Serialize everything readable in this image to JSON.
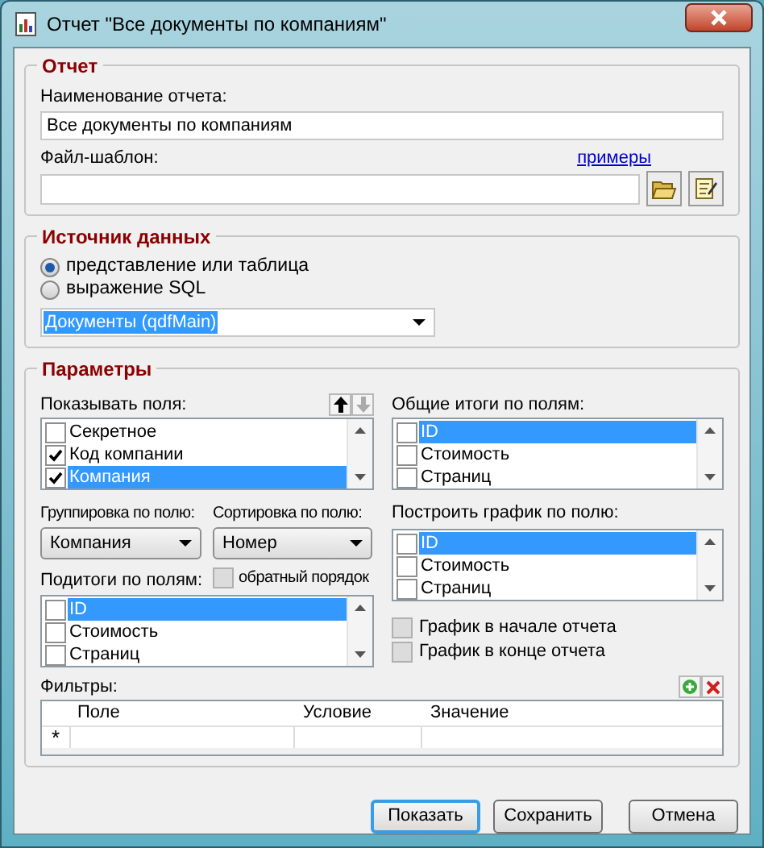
{
  "window": {
    "title": "Отчет \"Все документы по компаниям\""
  },
  "report": {
    "legend": "Отчет",
    "name_label": "Наименование отчета:",
    "name_value": "Все документы по компаниям",
    "template_label": "Файл-шаблон:",
    "examples_link": "примеры"
  },
  "source": {
    "legend": "Источник данных",
    "options": [
      {
        "label": "представление или таблица",
        "selected": true
      },
      {
        "label": "выражение SQL",
        "selected": false
      }
    ],
    "table": "Документы (qdfMain)"
  },
  "params": {
    "legend": "Параметры",
    "show_fields": {
      "label": "Показывать поля:",
      "items": [
        {
          "label": "Секретное",
          "checked": false,
          "selected": false
        },
        {
          "label": "Код компании",
          "checked": true,
          "selected": false
        },
        {
          "label": "Компания",
          "checked": true,
          "selected": true
        }
      ]
    },
    "totals": {
      "label": "Общие итоги по полям:",
      "items": [
        {
          "label": "ID",
          "checked": false,
          "selected": true
        },
        {
          "label": "Стоимость",
          "checked": false,
          "selected": false
        },
        {
          "label": "Страниц",
          "checked": false,
          "selected": false
        }
      ]
    },
    "group_by": {
      "label": "Группировка по полю:",
      "value": "Компания"
    },
    "sort_by": {
      "label": "Сортировка по полю:",
      "value": "Номер"
    },
    "reverse": {
      "label": "обратный порядок",
      "checked": false,
      "disabled": true
    },
    "subtotals": {
      "label": "Подитоги по полям:",
      "items": [
        {
          "label": "ID",
          "checked": false,
          "selected": true
        },
        {
          "label": "Стоимость",
          "checked": false,
          "selected": false
        },
        {
          "label": "Страниц",
          "checked": false,
          "selected": false
        }
      ]
    },
    "chart_by": {
      "label": "Построить график по полю:",
      "items": [
        {
          "label": "ID",
          "checked": false,
          "selected": true
        },
        {
          "label": "Стоимость",
          "checked": false,
          "selected": false
        },
        {
          "label": "Страниц",
          "checked": false,
          "selected": false
        }
      ]
    },
    "chart_options": [
      {
        "label": "График в начале отчета",
        "checked": false,
        "disabled": true
      },
      {
        "label": "График в конце отчета",
        "checked": false,
        "disabled": true
      }
    ],
    "filters": {
      "label": "Фильтры:",
      "columns": [
        "Поле",
        "Условие",
        "Значение"
      ],
      "new_row_marker": "*"
    }
  },
  "buttons": [
    {
      "label": "Показать",
      "default": true
    },
    {
      "label": "Сохранить",
      "default": false
    },
    {
      "label": "Отмена",
      "default": false
    }
  ]
}
